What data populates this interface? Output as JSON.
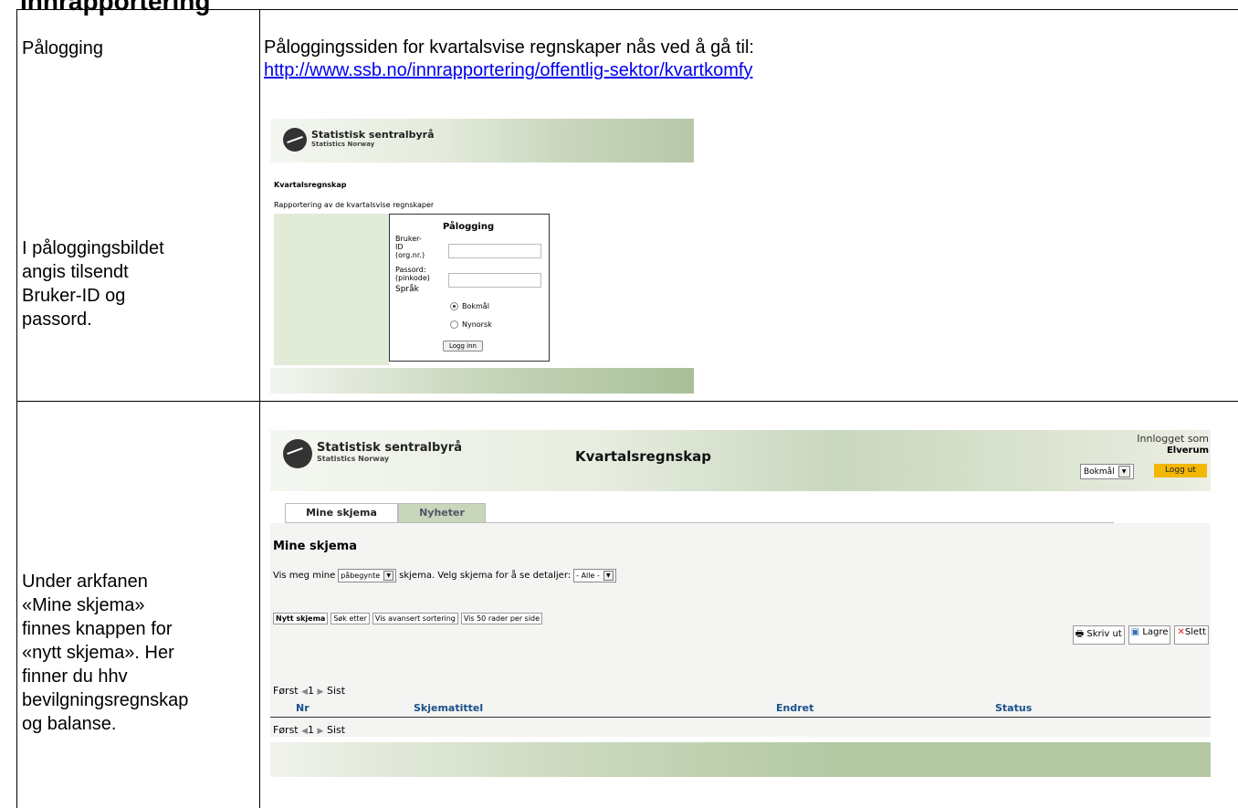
{
  "doc": {
    "heading": "Innrapportering",
    "row1_left_top": "Pålogging",
    "row1_left_bottom": [
      "I påloggingsbildet",
      "angis tilsendt",
      "Bruker-ID og",
      "passord."
    ],
    "row1_right_intro": "Påloggingssiden for kvartalsvise regnskaper nås ved å gå til:",
    "row1_right_link": "http://www.ssb.no/innrapportering/offentlig-sektor/kvartkomfy",
    "row2_left": [
      "Under arkfanen",
      "«Mine skjema»",
      "finnes knappen for",
      "«nytt skjema». Her",
      "finner du hhv",
      "bevilgningsregnskap",
      "og balanse."
    ]
  },
  "login_screen": {
    "logo_line1": "Statistisk sentralbyrå",
    "logo_line2": "Statistics Norway",
    "page_title": "Kvartalsregnskap",
    "subtitle": "Rapportering av de kvartalsvise regnskaper",
    "box_title": "Pålogging",
    "user_label": [
      "Bruker-",
      "ID",
      "(org.nr.)"
    ],
    "password_label": [
      "Passord:",
      "(pinkode)"
    ],
    "language_label": "Språk",
    "lang_option1": "Bokmål",
    "lang_option2": "Nynorsk",
    "selected_language": "Bokmål",
    "login_button": "Logg inn"
  },
  "app_screen": {
    "logo_line1": "Statistisk sentralbyrå",
    "logo_line2": "Statistics Norway",
    "app_title": "Kvartalsregnskap",
    "logged_in_as": "Innlogget som",
    "user_name": "Elverum",
    "language": "Bokmål",
    "logout": "Logg ut",
    "tabs": [
      {
        "label": "Mine skjema",
        "active": true
      },
      {
        "label": "Nyheter",
        "active": false
      }
    ],
    "section_title": "Mine skjema",
    "filter_prefix": "Vis meg mine",
    "filter_value": "påbegynte",
    "filter_middle": "skjema. Velg skjema for å se detaljer:",
    "filter_value2": "- Alle -",
    "buttons": [
      "Nytt skjema",
      "Søk etter",
      "Vis avansert sortering",
      "Vis 50 rader per side"
    ],
    "print": "Skriv ut",
    "save": "Lagre",
    "delete": "Slett",
    "nav_first": "Først",
    "nav_page": "1",
    "nav_last": "Sist",
    "columns": [
      "Nr",
      "Skjematittel",
      "Endret",
      "Status"
    ]
  }
}
